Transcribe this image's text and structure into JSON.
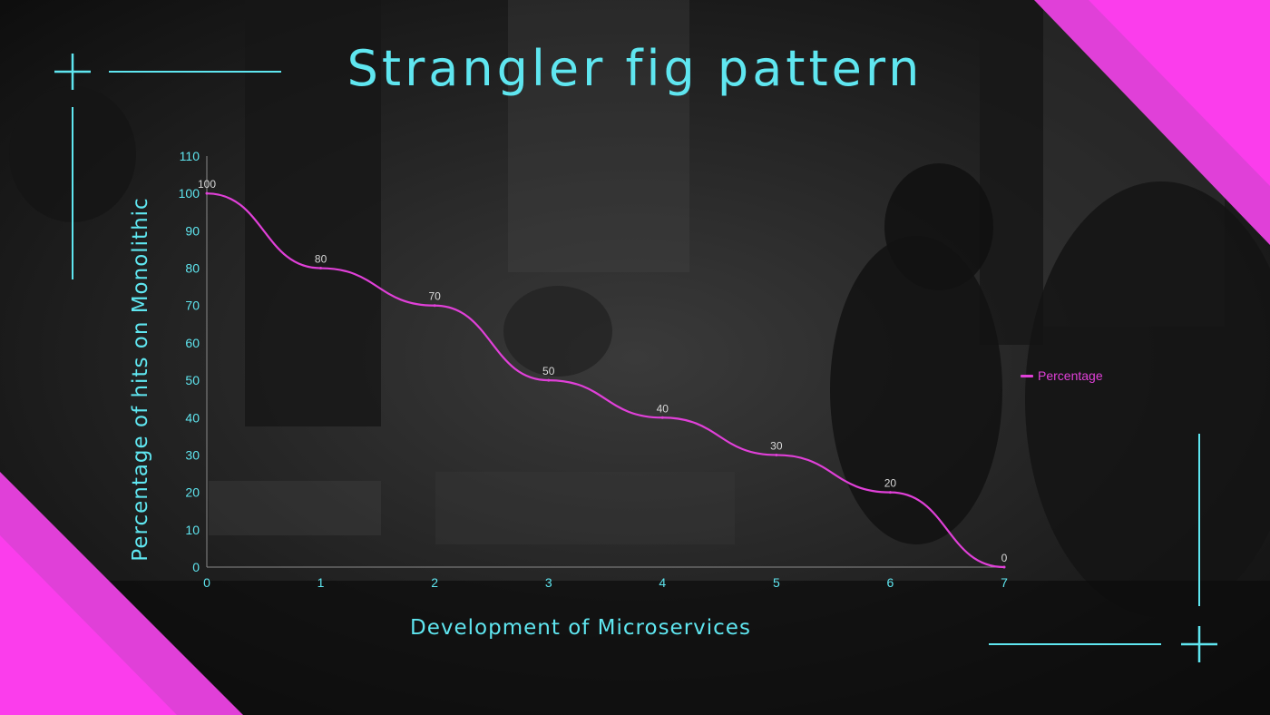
{
  "slide": {
    "title": "Strangler fig pattern",
    "accent_color": "#5fe6f0",
    "corner_color": "#e040d8",
    "background_image": "dark-office-meeting-photo"
  },
  "chart_data": {
    "type": "line",
    "title": "",
    "xlabel": "Development of Microservices",
    "ylabel": "Percentage of hits on Monolithic",
    "x": [
      0,
      1,
      2,
      3,
      4,
      5,
      6,
      7
    ],
    "series": [
      {
        "name": "Percentage",
        "values": [
          100,
          80,
          70,
          50,
          40,
          30,
          20,
          0
        ],
        "color": "#e040d8"
      }
    ],
    "data_labels": [
      "100",
      "80",
      "70",
      "50",
      "40",
      "30",
      "20",
      "0"
    ],
    "x_ticks": [
      "0",
      "1",
      "2",
      "3",
      "4",
      "5",
      "6",
      "7"
    ],
    "y_ticks": [
      "0",
      "10",
      "20",
      "30",
      "40",
      "50",
      "60",
      "70",
      "80",
      "90",
      "100",
      "110"
    ],
    "xlim": [
      0,
      7
    ],
    "ylim": [
      0,
      110
    ],
    "smooth": true,
    "grid": false,
    "legend": "right"
  }
}
